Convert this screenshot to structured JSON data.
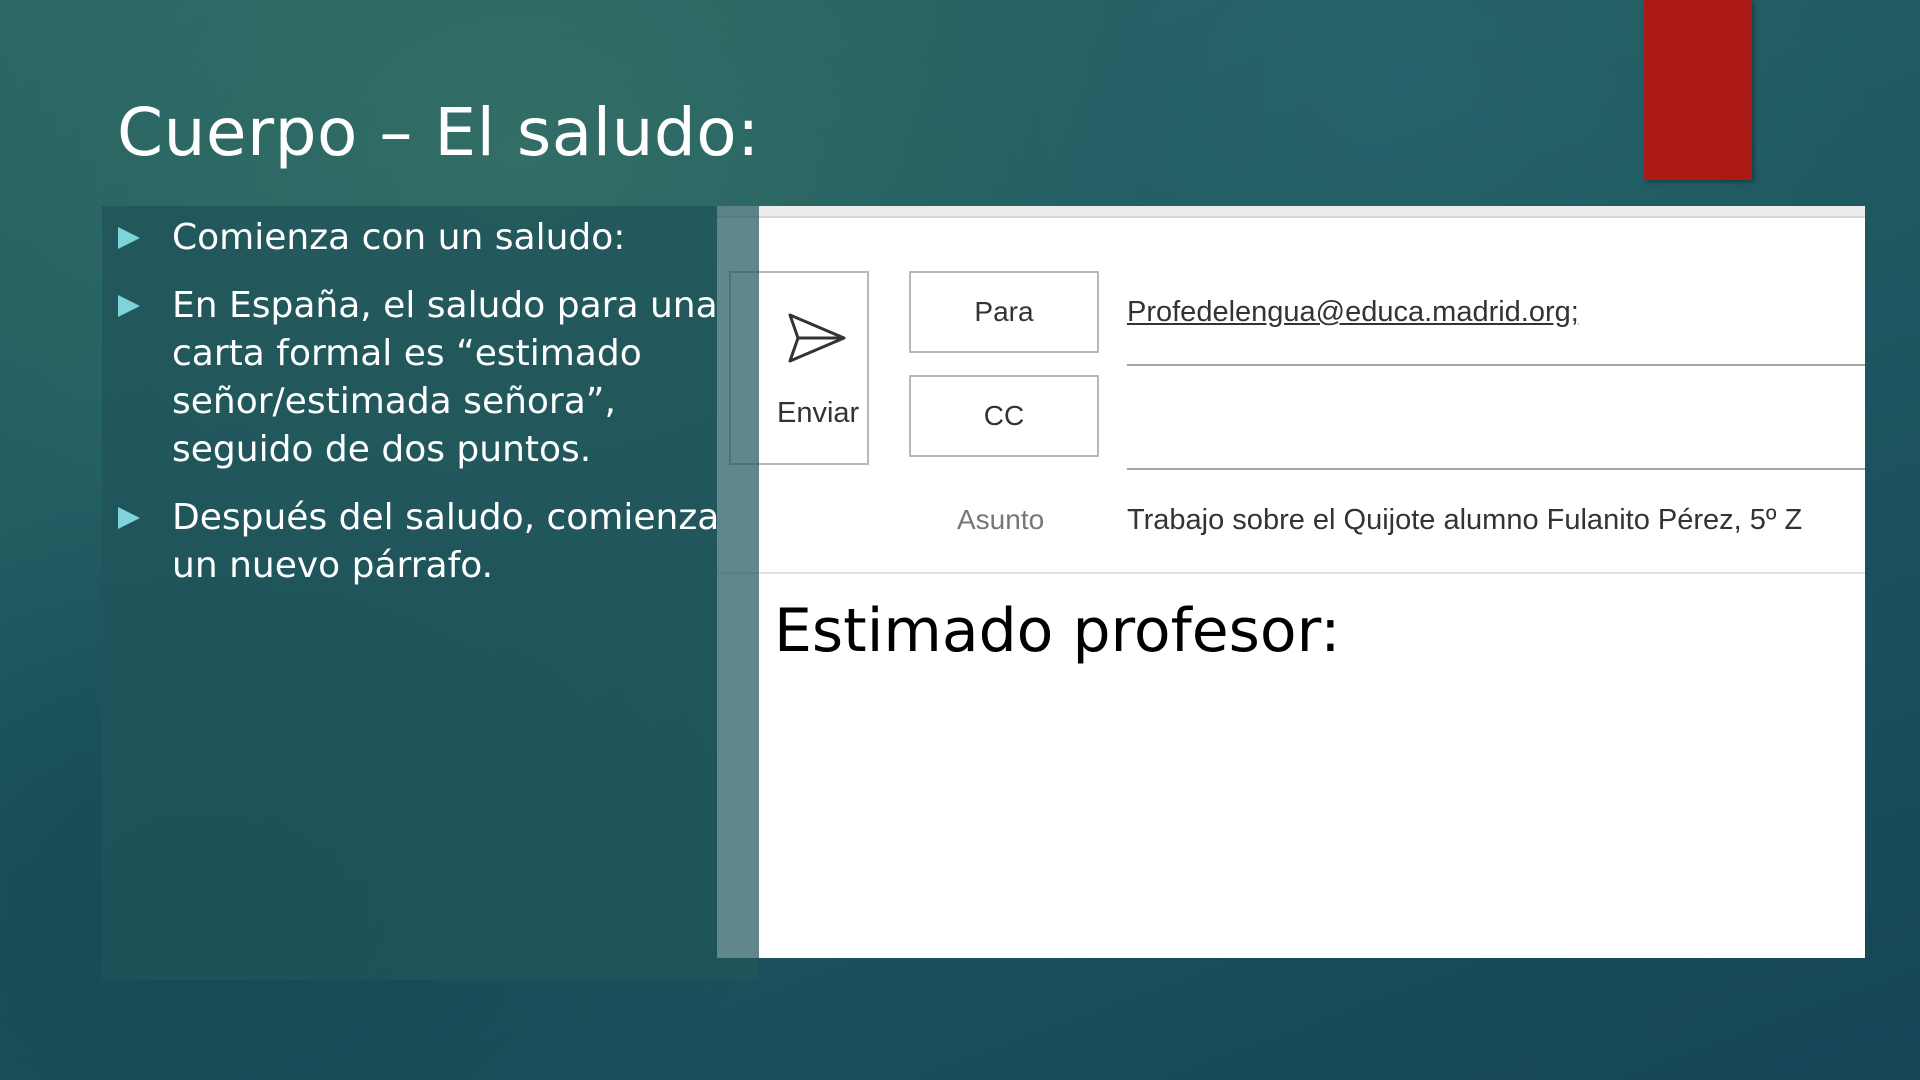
{
  "slide": {
    "title": "Cuerpo – El saludo:",
    "accent_color": "#ab1a17",
    "bullet_color": "#7fd4da",
    "bullets": [
      "Comienza con un saludo:",
      "En España, el saludo para una carta formal es “estimado señor/estimada señora”, seguido de dos puntos.",
      "Después del saludo, comienza un nuevo párrafo."
    ]
  },
  "email": {
    "send_label": "Enviar",
    "send_icon": "send-icon",
    "to_button_label": "Para",
    "cc_button_label": "CC",
    "to_value": "Profedelengua@educa.madrid.org;",
    "cc_value": "",
    "subject_label": "Asunto",
    "subject_value": "Trabajo sobre el Quijote alumno Fulanito Pérez, 5º Z",
    "body": "Estimado profesor:"
  }
}
